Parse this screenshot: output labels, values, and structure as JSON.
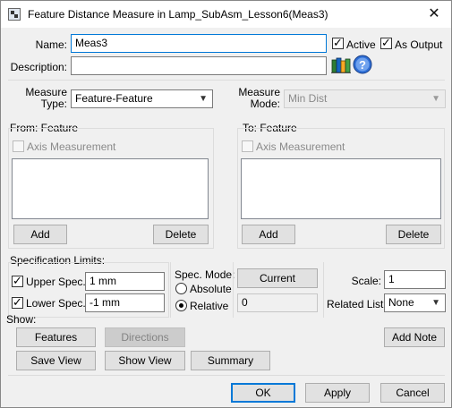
{
  "window": {
    "title": "Feature Distance Measure in Lamp_SubAsm_Lesson6(Meas3)",
    "close_glyph": "✕"
  },
  "name": {
    "label": "Name:",
    "value": "Meas3"
  },
  "description": {
    "label": "Description:",
    "value": ""
  },
  "active": {
    "label": "Active",
    "checked": true
  },
  "as_output": {
    "label": "As Output",
    "checked": true
  },
  "icons": {
    "library": "library-icon",
    "help": "help-icon"
  },
  "measure_type": {
    "label_line1": "Measure",
    "label_line2": "Type:",
    "value": "Feature-Feature"
  },
  "measure_mode": {
    "label_line1": "Measure",
    "label_line2": "Mode:",
    "value": "Min Dist"
  },
  "from": {
    "title": "From: Feature",
    "axis_label": "Axis Measurement",
    "add": "Add",
    "delete": "Delete"
  },
  "to": {
    "title": "To: Feature",
    "axis_label": "Axis Measurement",
    "add": "Add",
    "delete": "Delete"
  },
  "spec_limits": {
    "title": "Specification Limits:",
    "upper_label": "Upper Spec.:",
    "upper_value": "1 mm",
    "upper_checked": true,
    "lower_label": "Lower Spec.:",
    "lower_value": "-1 mm",
    "lower_checked": true
  },
  "spec_mode": {
    "title": "Spec. Mode:",
    "absolute": "Absolute",
    "relative": "Relative",
    "selected": "Relative"
  },
  "current": {
    "button": "Current",
    "value": "0"
  },
  "scale": {
    "label": "Scale:",
    "value": "1"
  },
  "related_list": {
    "label": "Related List:",
    "value": "None"
  },
  "show": {
    "title": "Show:",
    "features": "Features",
    "directions": "Directions",
    "add_note": "Add Note",
    "save_view": "Save View",
    "show_view": "Show View",
    "summary": "Summary"
  },
  "footer": {
    "ok": "OK",
    "apply": "Apply",
    "cancel": "Cancel"
  },
  "colors": {
    "accent": "#0078d7",
    "window_bg": "#f0f0f0",
    "button_bg": "#e1e1e1"
  }
}
